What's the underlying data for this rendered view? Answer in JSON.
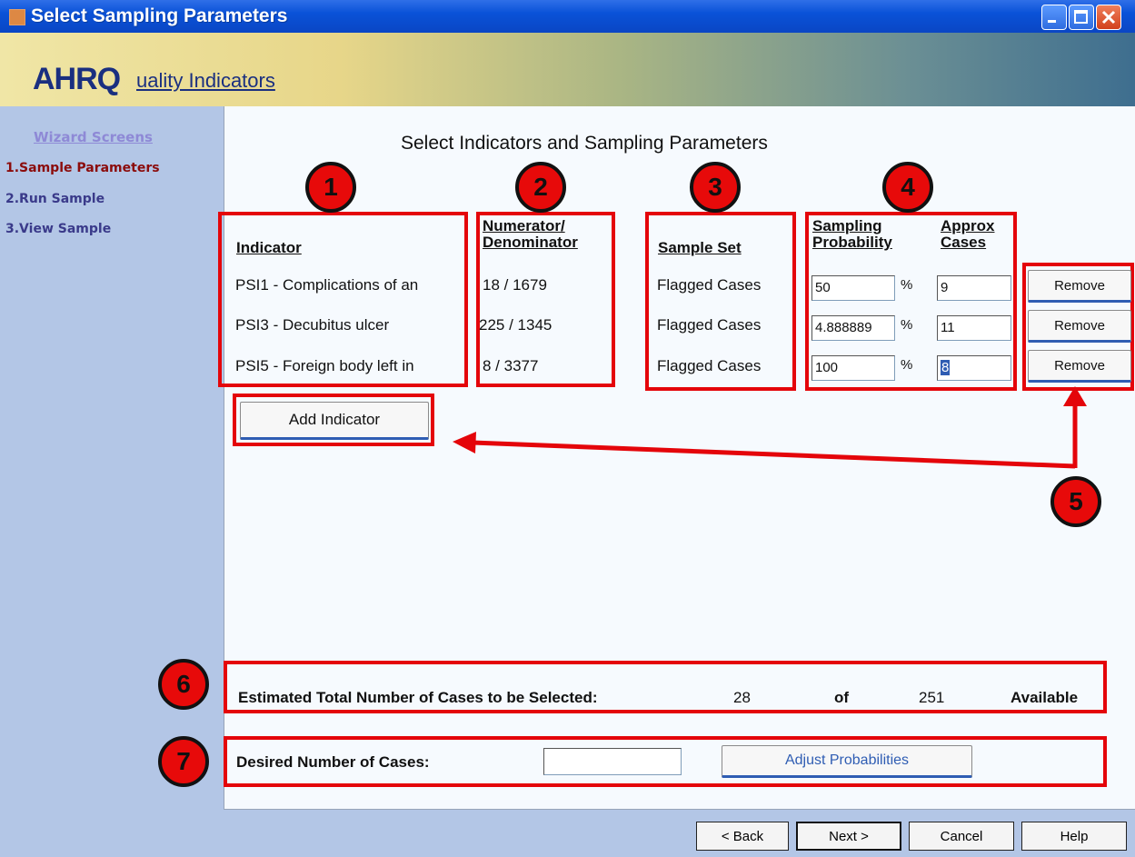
{
  "window": {
    "title": "Select Sampling Parameters"
  },
  "banner": {
    "logo_ahr": "AHRQ",
    "logo_rest": "uality Indicators"
  },
  "sidebar": {
    "heading": "Wizard Screens",
    "items": [
      {
        "label": "1.Sample Parameters",
        "active": true
      },
      {
        "label": "2.Run Sample",
        "active": false
      },
      {
        "label": "3.View Sample",
        "active": false
      }
    ]
  },
  "main": {
    "title": "Select Indicators and Sampling Parameters",
    "headers": {
      "indicator": "Indicator",
      "num_denom_1": "Numerator/",
      "num_denom_2": "Denominator",
      "sample_set": "Sample Set",
      "sampling_1": "Sampling",
      "sampling_2": "Probability",
      "approx_1": "Approx",
      "approx_2": "Cases"
    },
    "rows": [
      {
        "indicator": "PSI1 - Complications of an",
        "num_denom": "18 / 1679",
        "sample_set": "Flagged Cases",
        "probability": "50",
        "pct": "%",
        "cases": "9",
        "remove": "Remove"
      },
      {
        "indicator": "PSI3 - Decubitus ulcer",
        "num_denom": "225 / 1345",
        "sample_set": "Flagged Cases",
        "probability": "4.888889",
        "pct": "%",
        "cases": "11",
        "remove": "Remove"
      },
      {
        "indicator": "PSI5 - Foreign body left in",
        "num_denom": "8 / 3377",
        "sample_set": "Flagged Cases",
        "probability": "100",
        "pct": "%",
        "cases": "8",
        "remove": "Remove"
      }
    ],
    "add_indicator": "Add Indicator",
    "estimate": {
      "label": "Estimated Total Number of Cases to be Selected:",
      "count": "28",
      "of": "of",
      "total": "251",
      "available": "Available"
    },
    "desired": {
      "label": "Desired Number of Cases:",
      "value": "",
      "adjust": "Adjust Probabilities"
    }
  },
  "annotations": [
    "1",
    "2",
    "3",
    "4",
    "5",
    "6",
    "7"
  ],
  "nav": {
    "back": "< Back",
    "next": "Next >",
    "cancel": "Cancel",
    "help": "Help"
  },
  "colors": {
    "annotation_red": "#e4050a",
    "title_blue": "#0a52d8",
    "sidebar": "#b3c6e6",
    "active_item": "#8b0c0c"
  }
}
